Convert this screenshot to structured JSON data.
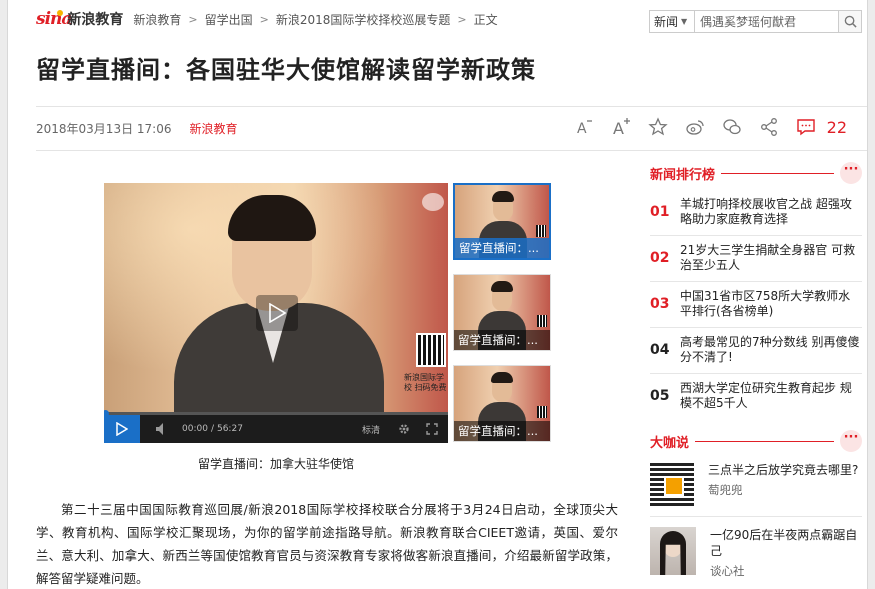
{
  "nav": {
    "logo_sina": "sina",
    "logo_edu": "新浪教育",
    "crumbs": [
      "新浪教育",
      "留学出国",
      "新浪2018国际学校择校巡展专题",
      "正文"
    ],
    "sep": ">"
  },
  "search": {
    "category": "新闻",
    "query": "偶遇奚梦瑶何猷君"
  },
  "article": {
    "title": "留学直播间：各国驻华大使馆解读留学新政策",
    "date": "2018年03月13日 17:06",
    "source": "新浪教育",
    "comment_count": "22",
    "body": "第二十三届中国国际教育巡回展/新浪2018国际学校择校联合分展将于3月24日启动，全球顶尖大学、教育机构、国际学校汇聚现场，为你的留学前途指路导航。新浪教育联合CIEET邀请，英国、爱尔兰、意大利、加拿大、新西兰等国使馆教育官员与资深教育专家将做客新浪直播间，介绍最新留学政策，解答留学疑难问题。"
  },
  "video": {
    "caption": "留学直播间：加拿大驻华使馆",
    "time_current": "00:00",
    "time_total": "56:27",
    "quality": "标清",
    "qr_text": "新浪国际学校 扫码免费",
    "progress": 0
  },
  "thumbs": [
    {
      "caption": "留学直播间：..."
    },
    {
      "caption": "留学直播间：..."
    },
    {
      "caption": "留学直播间：..."
    }
  ],
  "sidebar": {
    "ranking_title": "新闻排行榜",
    "more": "···",
    "ranking": [
      {
        "n": "01",
        "text": "羊城打响择校展收官之战 超强攻略助力家庭教育选择"
      },
      {
        "n": "02",
        "text": "21岁大三学生捐献全身器官 可救治至少五人"
      },
      {
        "n": "03",
        "text": "中国31省市区758所大学教师水平排行(各省榜单)"
      },
      {
        "n": "04",
        "text": "高考最常见的7种分数线 别再傻傻分不清了!"
      },
      {
        "n": "05",
        "text": "西湖大学定位研究生教育起步 规模不超5千人"
      }
    ],
    "talk_title": "大咖说",
    "talks": [
      {
        "title": "三点半之后放学究竟去哪里?",
        "author": "萄兜兜"
      },
      {
        "title": "一亿90后在半夜两点霸踞自己",
        "author": "谈心社"
      }
    ]
  },
  "colors": {
    "accent": "#e01f26",
    "player_blue": "#1a6fc7"
  }
}
